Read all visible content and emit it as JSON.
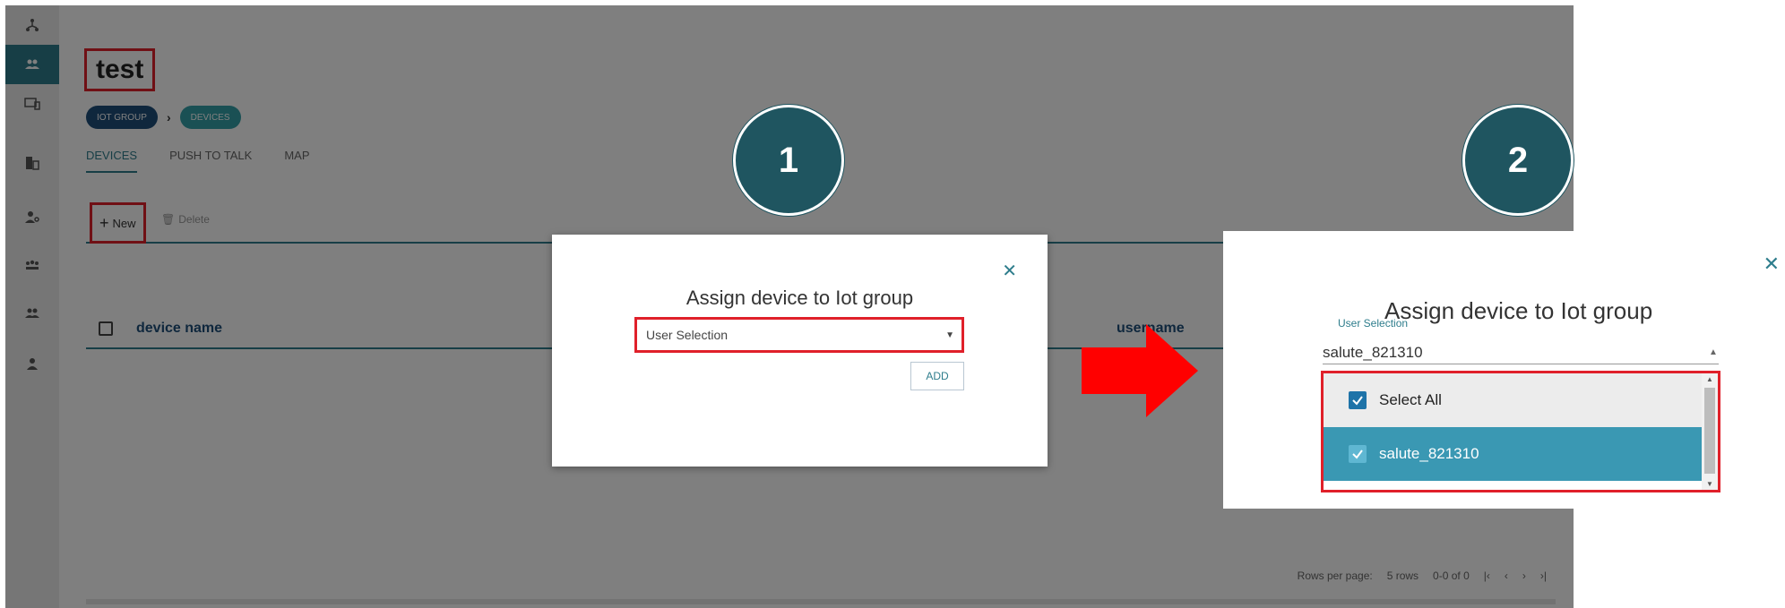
{
  "app": {
    "page_title": "test",
    "breadcrumb": [
      "IOT GROUP",
      "DEVICES"
    ],
    "tabs": [
      "DEVICES",
      "PUSH TO TALK",
      "MAP"
    ],
    "toolbar": {
      "new_label": "New",
      "delete_label": "Delete"
    },
    "table": {
      "columns": [
        "device name",
        "username"
      ]
    },
    "pagination": {
      "rows_per_page_label": "Rows per page:",
      "rows_value": "5 rows",
      "range": "0-0 of 0"
    }
  },
  "modal1": {
    "title": "Assign device to Iot group",
    "select_placeholder": "User Selection",
    "add_label": "ADD"
  },
  "badges": {
    "step1": "1",
    "step2": "2"
  },
  "panel2": {
    "title": "Assign device to Iot group",
    "field_label": "User Selection",
    "field_value": "salute_821310",
    "options": [
      {
        "label": "Select All",
        "checked": true
      },
      {
        "label": "salute_821310",
        "checked": true,
        "highlighted": true
      }
    ]
  },
  "colors": {
    "accent": "#2e7d8c",
    "highlight": "#e0202a",
    "badge": "#1f5560",
    "arrow": "#ff0000"
  }
}
